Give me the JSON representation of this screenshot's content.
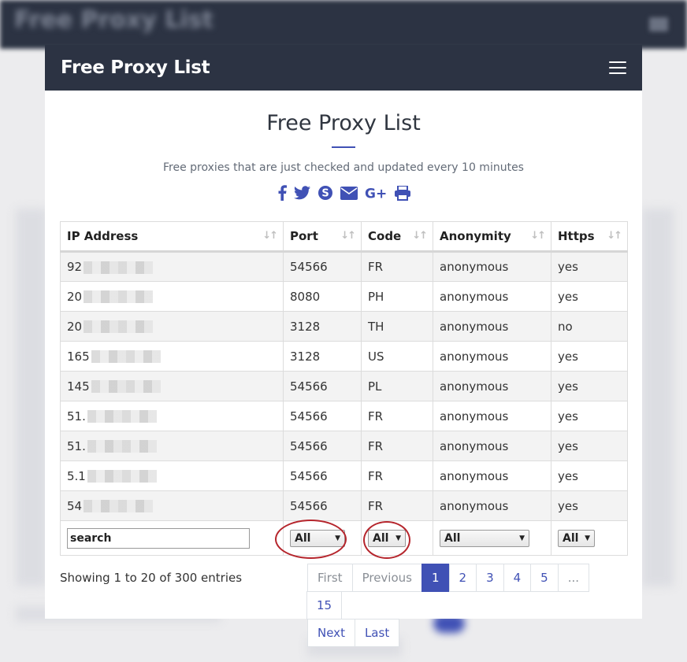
{
  "navbar": {
    "brand": "Free Proxy List"
  },
  "header": {
    "title": "Free Proxy List",
    "subtitle": "Free proxies that are just checked and updated every 10 minutes"
  },
  "share_icons": [
    "facebook-icon",
    "twitter-icon",
    "skype-icon",
    "email-icon",
    "google-plus-icon",
    "print-icon"
  ],
  "colors": {
    "accent": "#4051b5",
    "navbar": "#2c3343",
    "highlight_circle": "#b5252c"
  },
  "table": {
    "columns": [
      "IP Address",
      "Port",
      "Code",
      "Anonymity",
      "Https"
    ],
    "rows": [
      {
        "ip": "92",
        "port": "54566",
        "code": "FR",
        "anonymity": "anonymous",
        "https": "yes"
      },
      {
        "ip": "20",
        "port": "8080",
        "code": "PH",
        "anonymity": "anonymous",
        "https": "yes"
      },
      {
        "ip": "20",
        "port": "3128",
        "code": "TH",
        "anonymity": "anonymous",
        "https": "no"
      },
      {
        "ip": "165",
        "port": "3128",
        "code": "US",
        "anonymity": "anonymous",
        "https": "yes"
      },
      {
        "ip": "145",
        "port": "54566",
        "code": "PL",
        "anonymity": "anonymous",
        "https": "yes"
      },
      {
        "ip": "51.",
        "port": "54566",
        "code": "FR",
        "anonymity": "anonymous",
        "https": "yes"
      },
      {
        "ip": "51.",
        "port": "54566",
        "code": "FR",
        "anonymity": "anonymous",
        "https": "yes"
      },
      {
        "ip": "5.1",
        "port": "54566",
        "code": "FR",
        "anonymity": "anonymous",
        "https": "yes"
      },
      {
        "ip": "54",
        "port": "54566",
        "code": "FR",
        "anonymity": "anonymous",
        "https": "yes"
      }
    ],
    "filters": {
      "search_value": "search",
      "port": "All",
      "code": "All",
      "anonymity": "All",
      "https": "All"
    }
  },
  "info": "Showing 1 to 20 of 300 entries",
  "pagination": {
    "first": "First",
    "previous": "Previous",
    "pages": [
      "1",
      "2",
      "3",
      "4",
      "5",
      "...",
      "15"
    ],
    "active_page": "1",
    "next": "Next",
    "last": "Last"
  }
}
